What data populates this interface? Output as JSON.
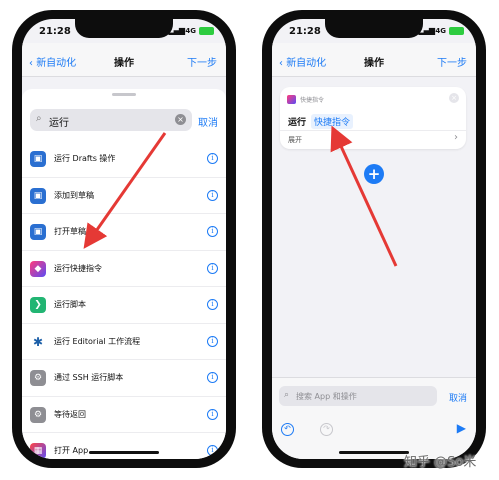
{
  "left_phone": {
    "status": {
      "time": "21:28",
      "network": "4G"
    },
    "nav": {
      "back": "新自动化",
      "title": "操作",
      "next": "下一步"
    },
    "search": {
      "query": "运行",
      "cancel": "取消"
    },
    "actions": [
      {
        "label": "运行 Drafts 操作",
        "icon": "drafts-icon",
        "color": "#2a6fd1"
      },
      {
        "label": "添加到草稿",
        "icon": "drafts-icon",
        "color": "#2a6fd1"
      },
      {
        "label": "打开草稿",
        "icon": "drafts-icon",
        "color": "#2a6fd1"
      },
      {
        "label": "运行快捷指令",
        "icon": "shortcuts-icon",
        "color": "#5b4cf5"
      },
      {
        "label": "运行脚本",
        "icon": "script-icon",
        "color": "#22b573"
      },
      {
        "label": "运行 Editorial 工作流程",
        "icon": "editorial-icon",
        "color": "#ffffff"
      },
      {
        "label": "通过 SSH 运行脚本",
        "icon": "ssh-icon",
        "color": "#8e8e93"
      },
      {
        "label": "等待返回",
        "icon": "wait-icon",
        "color": "#8e8e93"
      },
      {
        "label": "打开 App",
        "icon": "app-icon",
        "color": "#5b4cf5"
      }
    ]
  },
  "right_phone": {
    "status": {
      "time": "21:28",
      "network": "4G"
    },
    "nav": {
      "back": "新自动化",
      "title": "操作",
      "next": "下一步"
    },
    "card": {
      "category": "快捷指令",
      "action": "运行",
      "token": "快捷指令",
      "expand": "展开"
    },
    "bottom": {
      "search_placeholder": "搜索 App 和操作",
      "cancel": "取消"
    }
  },
  "watermark": "知乎 @So米"
}
